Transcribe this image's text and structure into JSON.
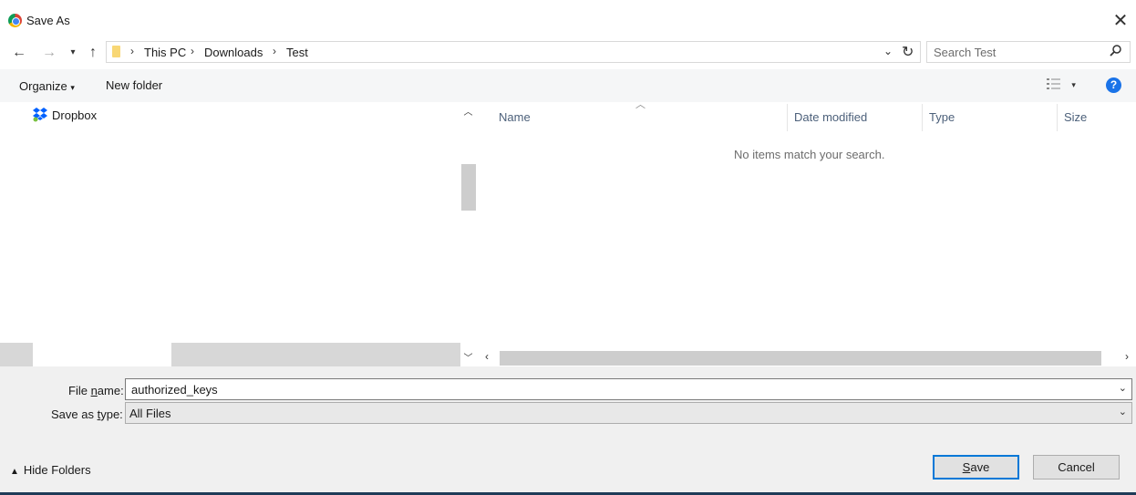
{
  "window": {
    "title": "Save As",
    "close_symbol": "✕"
  },
  "address_bar": {
    "breadcrumbs": [
      "This PC",
      "Downloads",
      "Test"
    ],
    "separator": "›"
  },
  "search": {
    "placeholder": "Search Test"
  },
  "toolbar": {
    "organize_label": "Organize",
    "new_folder_label": "New folder"
  },
  "nav_pane": {
    "items": [
      {
        "label": "Dropbox",
        "icon": "dropbox-icon"
      }
    ]
  },
  "file_list": {
    "columns": [
      "Name",
      "Date modified",
      "Type",
      "Size"
    ],
    "empty_message": "No items match your search."
  },
  "form": {
    "filename_label_pre": "File ",
    "filename_label_accel": "n",
    "filename_label_post": "ame:",
    "filename_value": "authorized_keys",
    "savetype_label_pre": "Save as ",
    "savetype_label_accel": "t",
    "savetype_label_post": "ype:",
    "savetype_value": "All Files"
  },
  "footer": {
    "hide_folders_label": "Hide Folders",
    "save_label_accel": "S",
    "save_label_rest": "ave",
    "cancel_label": "Cancel"
  },
  "colors": {
    "accent": "#0078d7",
    "help": "#1a73e8",
    "folder": "#f8d775"
  }
}
